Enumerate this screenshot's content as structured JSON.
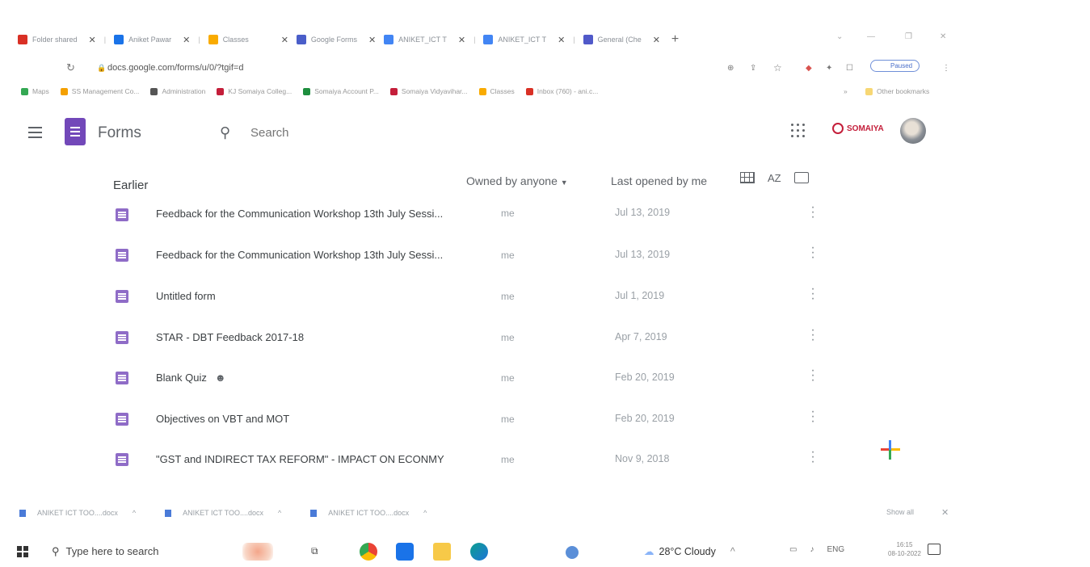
{
  "browser": {
    "tabs": [
      {
        "label": "Folder shared",
        "icon": "gmail-icon",
        "color": "#d93025"
      },
      {
        "label": "Aniket Pawar",
        "icon": "drive-icon",
        "color": "#1a73e8"
      },
      {
        "label": "Classes",
        "icon": "classroom-icon",
        "color": "#f9ab00"
      },
      {
        "label": "Google Forms",
        "icon": "forms-icon",
        "color": "#4a5ec9"
      },
      {
        "label": "ANIKET_ICT T",
        "icon": "docs-icon",
        "color": "#4285f4"
      },
      {
        "label": "ANIKET_ICT T",
        "icon": "docs-icon",
        "color": "#4285f4"
      },
      {
        "label": "General (Che",
        "icon": "teams-icon",
        "color": "#5059c9"
      }
    ],
    "address": "docs.google.com/forms/u/0/?tgif=d",
    "profile_status": "Paused",
    "bookmarks": [
      {
        "label": "Maps",
        "color": "#34a853"
      },
      {
        "label": "SS Management Co...",
        "color": "#f4a000"
      },
      {
        "label": "Administration",
        "color": "#555555"
      },
      {
        "label": "KJ Somaiya Colleg...",
        "color": "#c41e3a"
      },
      {
        "label": "Somaiya Account P...",
        "color": "#1e8e3e"
      },
      {
        "label": "Somaiya Vidyavihar...",
        "color": "#c41e3a"
      },
      {
        "label": "Classes",
        "color": "#f9ab00"
      },
      {
        "label": "Inbox (760) - ani.c...",
        "color": "#d93025"
      }
    ],
    "other_bookmarks": "Other bookmarks"
  },
  "app": {
    "name": "Forms",
    "search_placeholder": "Search",
    "org_name": "SOMAIYA"
  },
  "list": {
    "section": "Earlier",
    "owner_filter": "Owned by anyone",
    "sort_label": "Last opened by me",
    "sort_icon_label": "AZ",
    "items": [
      {
        "title": "Feedback for the Communication Workshop 13th July Sessi...",
        "owner": "me",
        "date": "Jul 13, 2019",
        "shared": false
      },
      {
        "title": "Feedback for the Communication Workshop 13th July Sessi...",
        "owner": "me",
        "date": "Jul 13, 2019",
        "shared": false
      },
      {
        "title": "Untitled form",
        "owner": "me",
        "date": "Jul 1, 2019",
        "shared": false
      },
      {
        "title": "STAR - DBT Feedback 2017-18",
        "owner": "me",
        "date": "Apr 7, 2019",
        "shared": false
      },
      {
        "title": "Blank Quiz",
        "owner": "me",
        "date": "Feb 20, 2019",
        "shared": true
      },
      {
        "title": "Objectives on VBT and MOT",
        "owner": "me",
        "date": "Feb 20, 2019",
        "shared": false
      },
      {
        "title": "\"GST and INDIRECT TAX REFORM\" - IMPACT ON ECONMY",
        "owner": "me",
        "date": "Nov 9, 2018",
        "shared": false
      }
    ]
  },
  "downloads": {
    "files": [
      "ANIKET ICT TOO....docx",
      "ANIKET ICT TOO....docx",
      "ANIKET ICT TOO....docx"
    ],
    "show_all": "Show all"
  },
  "taskbar": {
    "search_placeholder": "Type here to search",
    "weather": "28°C  Cloudy",
    "lang": "ENG",
    "time": "16:15",
    "date": "08-10-2022"
  }
}
